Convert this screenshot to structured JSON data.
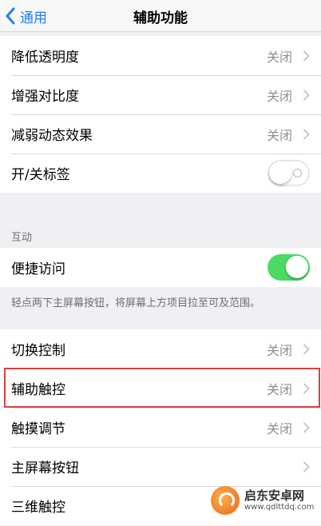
{
  "navbar": {
    "back_label": "通用",
    "title": "辅助功能"
  },
  "group1": {
    "items": [
      {
        "label": "降低透明度",
        "value": "关闭"
      },
      {
        "label": "增强对比度",
        "value": "关闭"
      },
      {
        "label": "减弱动态效果",
        "value": "关闭"
      },
      {
        "label": "开/关标签",
        "toggle": "off"
      }
    ]
  },
  "section_interaction": {
    "header": "互动"
  },
  "group2": {
    "items": [
      {
        "label": "便捷访问",
        "toggle": "on"
      }
    ],
    "footnote": "轻点两下主屏幕按钮，将屏幕上方项目拉至可及范围。"
  },
  "group3": {
    "items": [
      {
        "label": "切换控制",
        "value": "关闭"
      },
      {
        "label": "辅助触控",
        "value": "关闭",
        "highlighted": true
      },
      {
        "label": "触摸调节",
        "value": "关闭"
      },
      {
        "label": "主屏幕按钮",
        "value": ""
      },
      {
        "label": "三维触控",
        "value": ""
      }
    ]
  },
  "watermark": {
    "name": "启东安卓网",
    "url": "www.qdlttdq.com"
  },
  "colors": {
    "accent": "#1f7ff5",
    "toggle_on": "#4cd964",
    "highlight": "#d9423f"
  }
}
